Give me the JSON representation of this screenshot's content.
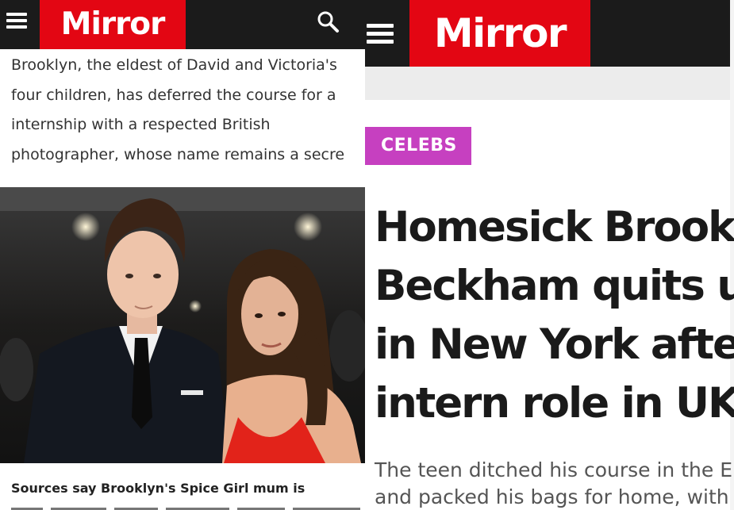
{
  "left_panel": {
    "header": {
      "logo": "Mirror"
    },
    "intro_lines": [
      "Brooklyn, the eldest of David and Victoria's",
      "four children, has deferred the course for a",
      "internship with a respected British",
      "photographer, whose name remains a secre"
    ],
    "photo_caption": "Sources say Brooklyn's Spice Girl mum is"
  },
  "right_panel": {
    "header": {
      "logo": "Mirror"
    },
    "category_tag": "CELEBS",
    "headline_lines": [
      "Homesick Brooklyn",
      "Beckham quits unive",
      "in New York after la",
      "intern role in UK"
    ],
    "standfirst_lines": [
      "The teen ditched his course in the E",
      "and packed his bags for home, with"
    ]
  },
  "colors": {
    "brand_red": "#e30613",
    "header_dark": "#1b1b1b",
    "celebs_tag": "#c640c0"
  },
  "icons": [
    "menu-icon",
    "search-icon"
  ]
}
